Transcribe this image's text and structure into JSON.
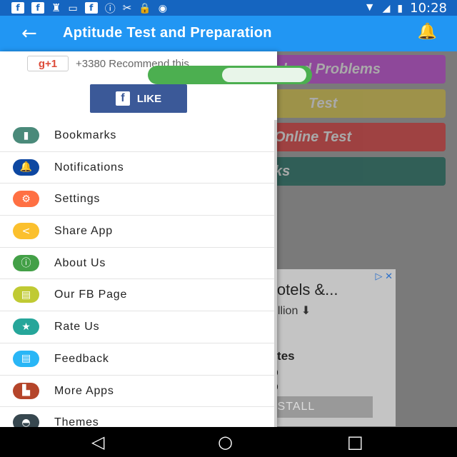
{
  "status_bar": {
    "time": "10:28",
    "left_icons": [
      "facebook-icon",
      "facebook-icon",
      "chess-icon",
      "card-icon",
      "facebook-icon",
      "info-icon",
      "sync-icon",
      "lock-icon",
      "android-icon"
    ],
    "right_icons": [
      "wifi-icon",
      "signal-icon",
      "battery-icon"
    ]
  },
  "app_bar": {
    "title": "Aptitude Test and Preparation",
    "back_icon": "←",
    "bell_icon": "🔔",
    "color": "#2196f3"
  },
  "background": {
    "buttons": [
      {
        "label": "olved Problems",
        "color": "#9c27b0"
      },
      {
        "label": "Test",
        "color": "#b5a22a"
      },
      {
        "label": "Online Test",
        "color": "#b71c1c"
      },
      {
        "label": "ks",
        "color": "#004d40"
      }
    ],
    "ad": {
      "title": "Hotels &...",
      "subtitle": "million ⬇",
      "sites": "Sites",
      "line1": "pp",
      "line2": "pp",
      "install": "NSTALL",
      "close": "▷ ✕"
    }
  },
  "drawer": {
    "gplus_label": "g+1",
    "recommend_text": "+3380 Recommend this",
    "fb_like_label": "LIKE",
    "fb_icon": "f",
    "toggle_state": "on",
    "items": [
      {
        "label": "Bookmarks",
        "icon": "bookmark-icon",
        "glyph": "▮",
        "color": "#4a8a7a"
      },
      {
        "label": "Notifications",
        "icon": "bell-icon",
        "glyph": "🔔",
        "color": "#0d47a1"
      },
      {
        "label": "Settings",
        "icon": "gear-icon",
        "glyph": "⚙",
        "color": "#ff7043"
      },
      {
        "label": "Share App",
        "icon": "share-icon",
        "glyph": "<",
        "color": "#fbc02d"
      },
      {
        "label": "About Us",
        "icon": "info-icon",
        "glyph": "ⓘ",
        "color": "#43a047"
      },
      {
        "label": "Our FB Page",
        "icon": "pages-icon",
        "glyph": "▤",
        "color": "#c0ca33"
      },
      {
        "label": "Rate Us",
        "icon": "star-icon",
        "glyph": "★",
        "color": "#26a69a"
      },
      {
        "label": "Feedback",
        "icon": "feedback-icon",
        "glyph": "▤",
        "color": "#29b6f6"
      },
      {
        "label": "More Apps",
        "icon": "apps-icon",
        "glyph": "▙",
        "color": "#b5452a"
      },
      {
        "label": "Themes",
        "icon": "palette-icon",
        "glyph": "◓",
        "color": "#37474f"
      }
    ]
  },
  "nav_bar": {
    "back": "◁",
    "home": "○",
    "recents": "□"
  }
}
